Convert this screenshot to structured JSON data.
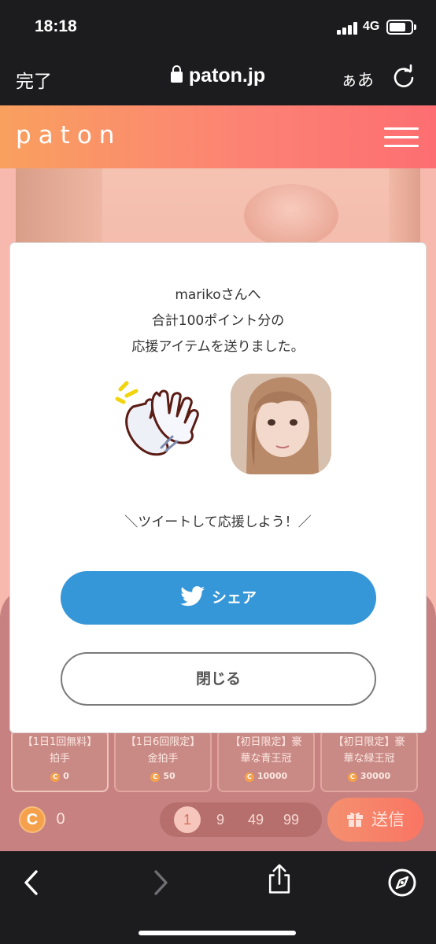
{
  "status_bar": {
    "time": "18:18",
    "network": "4G",
    "battery_level": 0.75
  },
  "browser": {
    "done_label": "完了",
    "url": "paton.jp",
    "text_size_label": "ぁあ",
    "icons": {
      "lock": "lock-icon",
      "reload": "reload-icon",
      "back": "back-arrow-icon",
      "forward": "forward-arrow-icon",
      "share": "share-icon",
      "bookmarks": "compass-icon"
    }
  },
  "site": {
    "logo": "paton",
    "menu_icon": "hamburger-menu-icon"
  },
  "modal": {
    "message_line1": "marikoさんへ",
    "message_line2": "合計100ポイント分の",
    "message_line3": "応援アイテムを送りました。",
    "item_icon": "clapping-hands-icon",
    "cheer_text": "＼ツイートして応援しよう！／",
    "share_label": "シェア",
    "close_label": "閉じる"
  },
  "items": [
    {
      "label_line1": "【1日1回無料】",
      "label_line2": "拍手",
      "cost": "0"
    },
    {
      "label_line1": "【1日6回限定】",
      "label_line2": "金拍手",
      "cost": "50"
    },
    {
      "label_line1": "【初日限定】豪",
      "label_line2": "華な青王冠",
      "cost": "10000"
    },
    {
      "label_line1": "【初日限定】豪",
      "label_line2": "華な緑王冠",
      "cost": "30000"
    }
  ],
  "purchase": {
    "coin_symbol": "C",
    "coin_balance": "0",
    "quantity_options": [
      "1",
      "9",
      "49",
      "99"
    ],
    "send_label": "送信"
  },
  "colors": {
    "header_gradient_start": "#f9a05f",
    "header_gradient_end": "#fd6e72",
    "share_button": "#3596d8"
  }
}
